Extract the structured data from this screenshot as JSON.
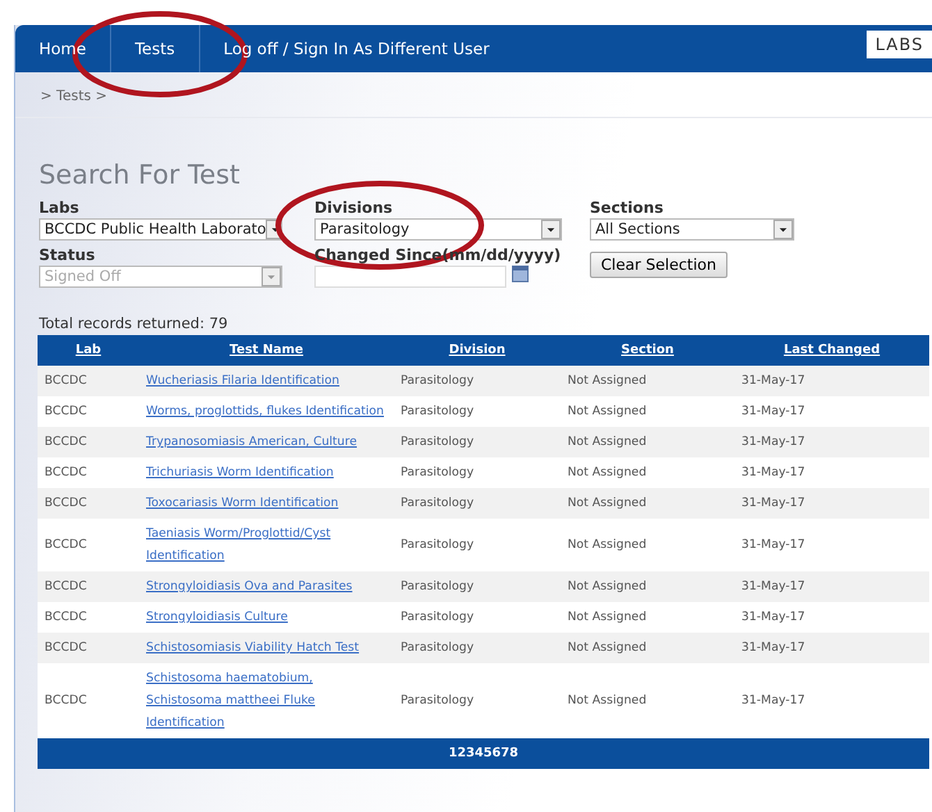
{
  "nav": {
    "items": [
      {
        "label": "Home"
      },
      {
        "label": "Tests"
      },
      {
        "label": "Log off / Sign In As Different User"
      }
    ],
    "logo": "LABS"
  },
  "breadcrumb": "> Tests >",
  "title": "Search For Test",
  "filters": [
    {
      "kind": "select",
      "label": "Labs",
      "value": "BCCDC Public Health Laborato",
      "disabled": false
    },
    {
      "kind": "select",
      "label": "Divisions",
      "value": "Parasitology",
      "disabled": false
    },
    {
      "kind": "select",
      "label": "Sections",
      "value": "All Sections",
      "disabled": false
    },
    {
      "kind": "select",
      "label": "Status",
      "value": "Signed Off",
      "disabled": true
    },
    {
      "kind": "date",
      "label": "Changed Since(mm/dd/yyyy)"
    },
    {
      "kind": "button",
      "label": "Clear Selection"
    }
  ],
  "total": "Total records returned: 79",
  "table": {
    "columns": [
      "Lab",
      "Test Name",
      "Division",
      "Section",
      "Last Changed"
    ],
    "rows": [
      [
        "BCCDC",
        "Wucheriasis Filaria Identification",
        "Parasitology",
        "Not Assigned",
        "31-May-17"
      ],
      [
        "BCCDC",
        "Worms, proglottids, flukes Identification",
        "Parasitology",
        "Not Assigned",
        "31-May-17"
      ],
      [
        "BCCDC",
        "Trypanosomiasis American, Culture",
        "Parasitology",
        "Not Assigned",
        "31-May-17"
      ],
      [
        "BCCDC",
        "Trichuriasis Worm Identification",
        "Parasitology",
        "Not Assigned",
        "31-May-17"
      ],
      [
        "BCCDC",
        "Toxocariasis Worm Identification",
        "Parasitology",
        "Not Assigned",
        "31-May-17"
      ],
      [
        "BCCDC",
        "Taeniasis Worm/Proglottid/Cyst Identification",
        "Parasitology",
        "Not Assigned",
        "31-May-17"
      ],
      [
        "BCCDC",
        "Strongyloidiasis Ova and Parasites",
        "Parasitology",
        "Not Assigned",
        "31-May-17"
      ],
      [
        "BCCDC",
        "Strongyloidiasis Culture",
        "Parasitology",
        "Not Assigned",
        "31-May-17"
      ],
      [
        "BCCDC",
        "Schistosomiasis Viability Hatch Test",
        "Parasitology",
        "Not Assigned",
        "31-May-17"
      ],
      [
        "BCCDC",
        "Schistosoma haematobium, Schistosoma mattheei Fluke Identification",
        "Parasitology",
        "Not Assigned",
        "31-May-17"
      ]
    ],
    "pages": [
      "1",
      "2",
      "3",
      "4",
      "5",
      "6",
      "7",
      "8"
    ]
  }
}
